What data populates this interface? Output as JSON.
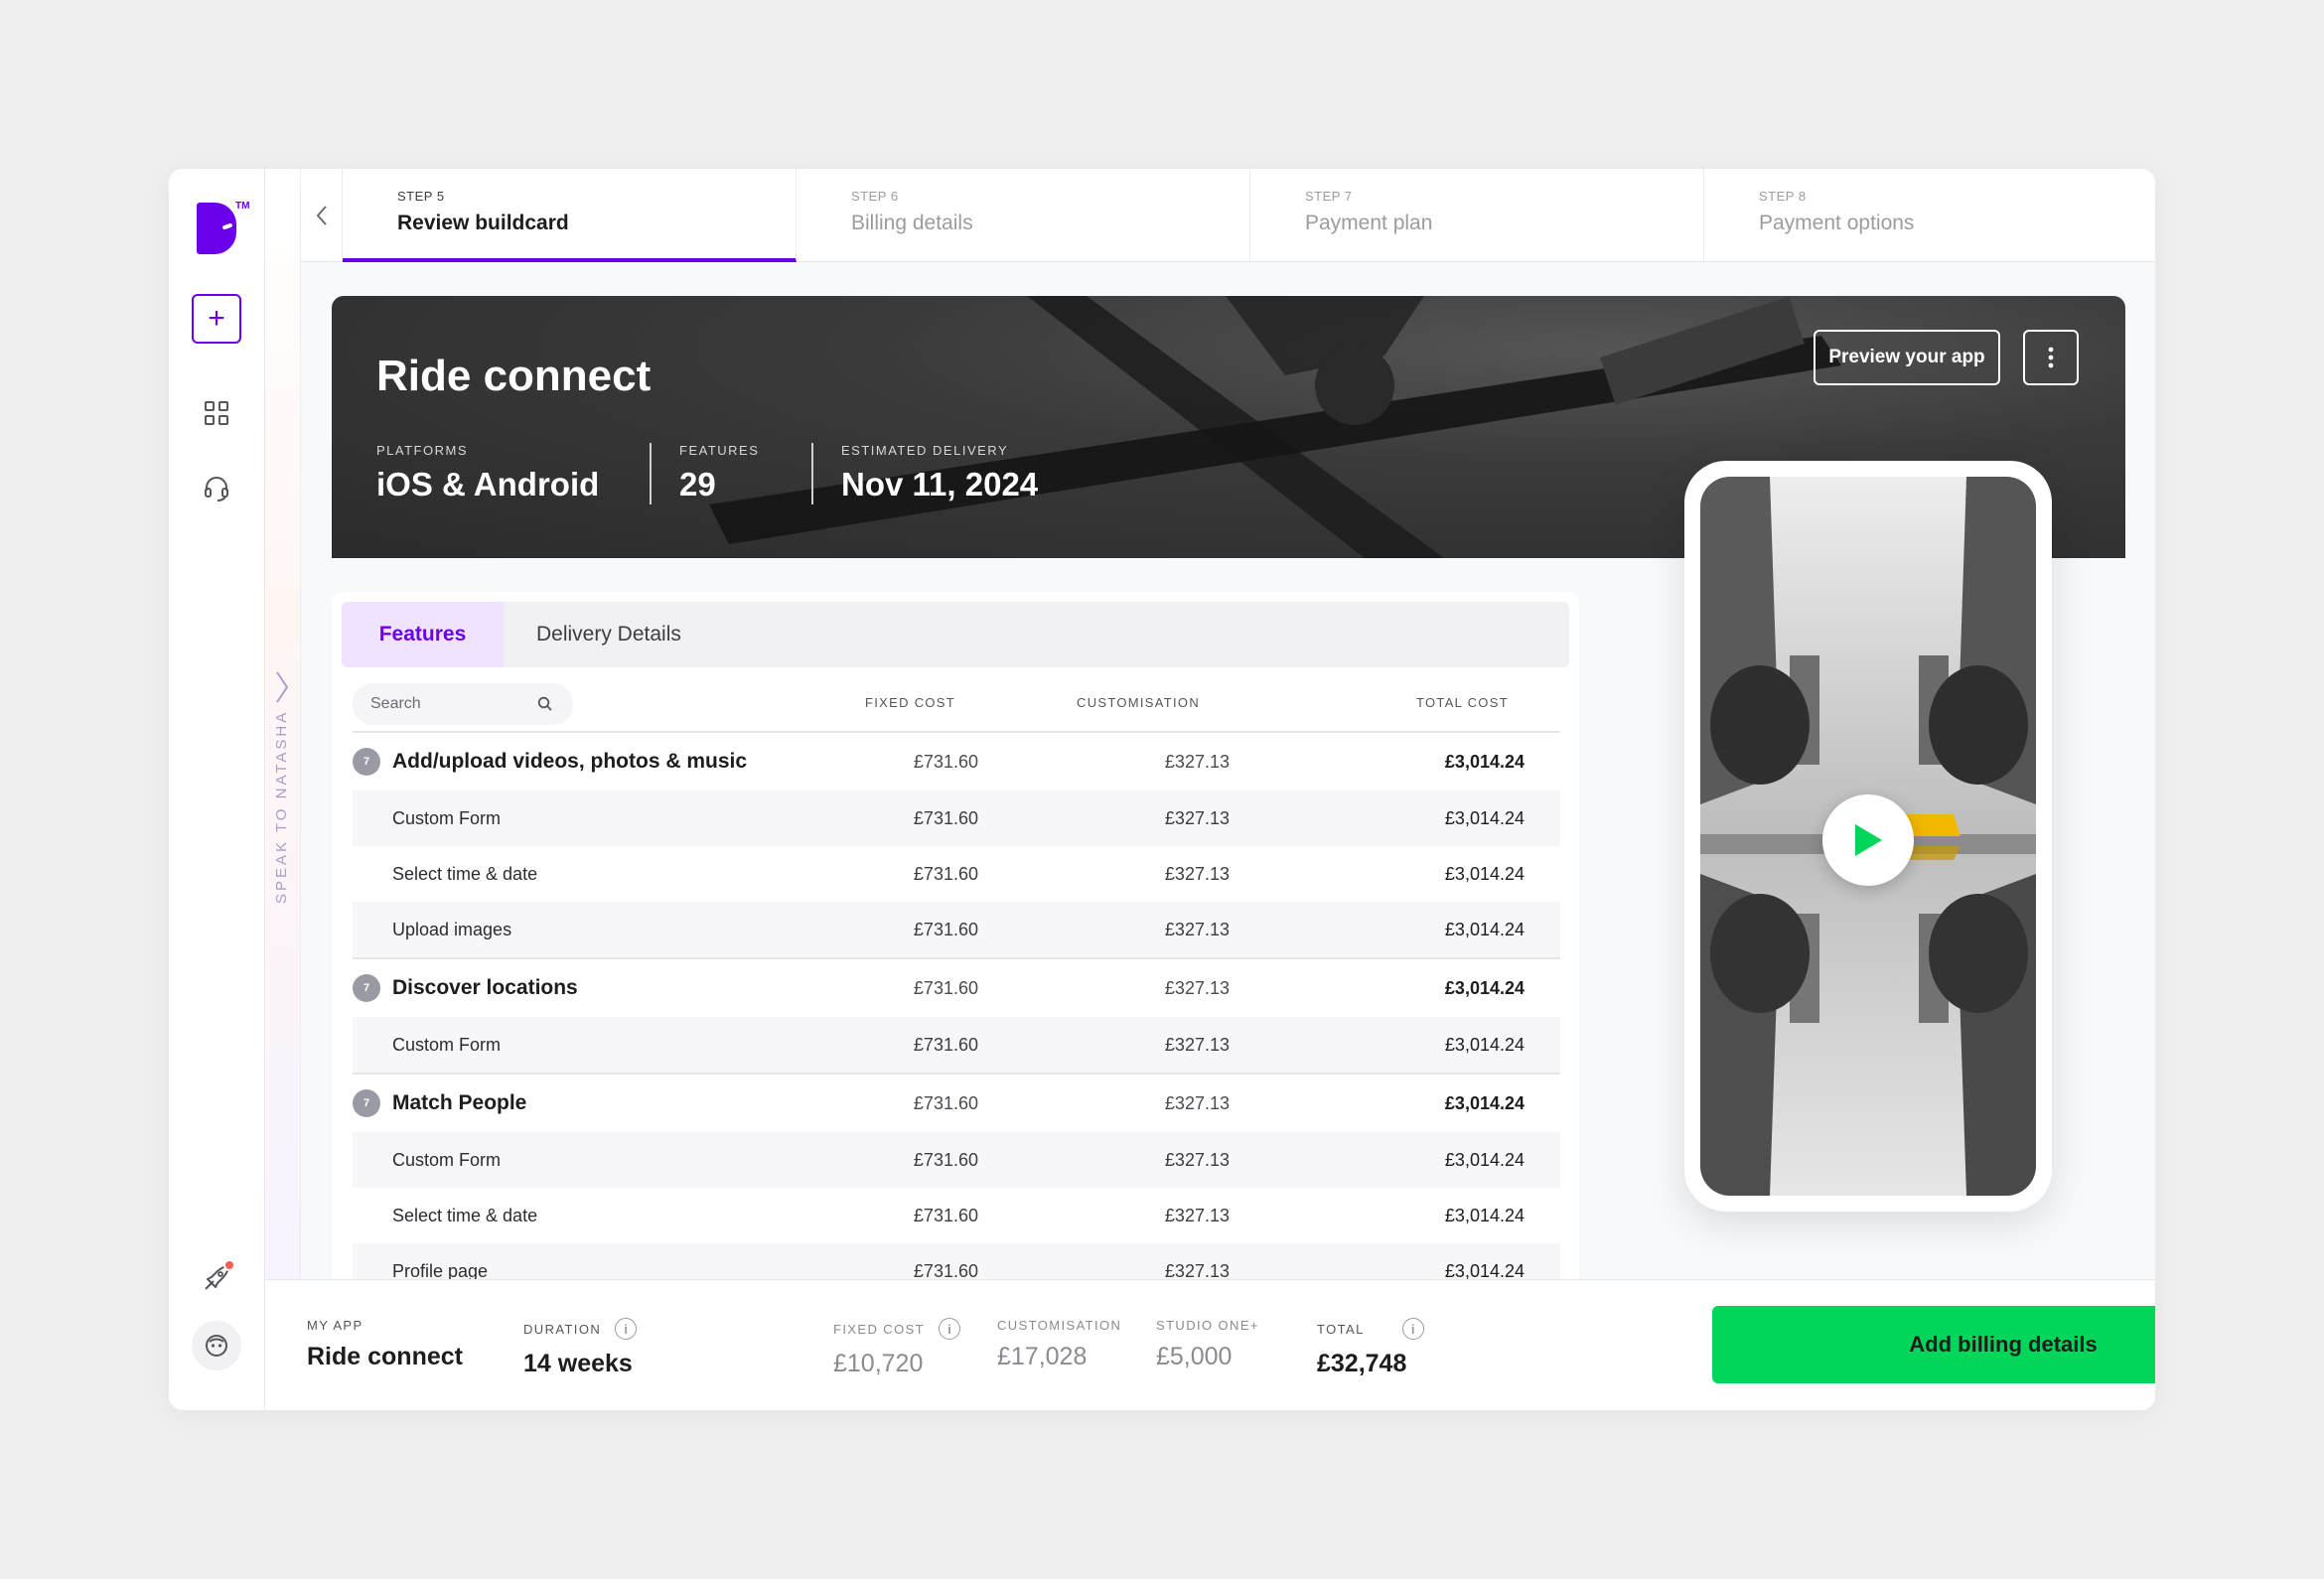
{
  "stepper": {
    "steps": [
      {
        "num": "STEP 5",
        "title": "Review buildcard",
        "active": true
      },
      {
        "num": "STEP 6",
        "title": "Billing details",
        "active": false
      },
      {
        "num": "STEP 7",
        "title": "Payment plan",
        "active": false
      },
      {
        "num": "STEP 8",
        "title": "Payment options",
        "active": false
      }
    ]
  },
  "sidebar": {
    "speak_label": "SPEAK TO NATASHA",
    "icons": [
      "brand-logo",
      "add-icon",
      "dashboard-icon",
      "headset-icon",
      "rocket-icon",
      "avatar-icon"
    ],
    "logo_tm": "TM"
  },
  "hero": {
    "title": "Ride connect",
    "platforms_label": "PLATFORMS",
    "platforms_value": "iOS & Android",
    "features_label": "FEATURES",
    "features_value": "29",
    "delivery_label": "ESTIMATED DELIVERY",
    "delivery_value": "Nov 11, 2024",
    "preview_label": "Preview your app"
  },
  "features": {
    "tabs": [
      {
        "label": "Features",
        "active": true
      },
      {
        "label": "Delivery Details",
        "active": false
      }
    ],
    "search_placeholder": "Search",
    "columns": {
      "fixed": "FIXED COST",
      "custom": "CUSTOMISATION",
      "total": "TOTAL COST"
    },
    "rows": [
      {
        "type": "group",
        "badge": "7",
        "name": "Add/upload videos, photos & music",
        "fixed": "£731.60",
        "custom": "£327.13",
        "total": "£3,014.24"
      },
      {
        "type": "sub",
        "name": "Custom Form",
        "fixed": "£731.60",
        "custom": "£327.13",
        "total": "£3,014.24"
      },
      {
        "type": "sub",
        "name": "Select time & date",
        "fixed": "£731.60",
        "custom": "£327.13",
        "total": "£3,014.24"
      },
      {
        "type": "sub",
        "name": "Upload images",
        "fixed": "£731.60",
        "custom": "£327.13",
        "total": "£3,014.24"
      },
      {
        "type": "group",
        "badge": "7",
        "name": "Discover locations",
        "fixed": "£731.60",
        "custom": "£327.13",
        "total": "£3,014.24"
      },
      {
        "type": "sub",
        "name": "Custom Form",
        "fixed": "£731.60",
        "custom": "£327.13",
        "total": "£3,014.24"
      },
      {
        "type": "group",
        "badge": "7",
        "name": "Match People",
        "fixed": "£731.60",
        "custom": "£327.13",
        "total": "£3,014.24"
      },
      {
        "type": "sub",
        "name": "Custom Form",
        "fixed": "£731.60",
        "custom": "£327.13",
        "total": "£3,014.24"
      },
      {
        "type": "sub",
        "name": "Select time & date",
        "fixed": "£731.60",
        "custom": "£327.13",
        "total": "£3,014.24"
      },
      {
        "type": "sub",
        "name": "Profile page",
        "fixed": "£731.60",
        "custom": "£327.13",
        "total": "£3,014.24"
      }
    ]
  },
  "bottom": {
    "my_app_label": "MY APP",
    "my_app_value": "Ride connect",
    "duration_label": "DURATION",
    "duration_value": "14 weeks",
    "fixed_label": "FIXED COST",
    "fixed_value": "£10,720",
    "custom_label": "CUSTOMISATION",
    "custom_value": "£17,028",
    "studio_label": "STUDIO ONE+",
    "studio_value": "£5,000",
    "total_label": "TOTAL",
    "total_value": "£32,748",
    "cta_label": "Add billing details"
  },
  "colors": {
    "accent": "#6c00ea",
    "cta": "#00d659",
    "notification": "#ff5a4e"
  }
}
